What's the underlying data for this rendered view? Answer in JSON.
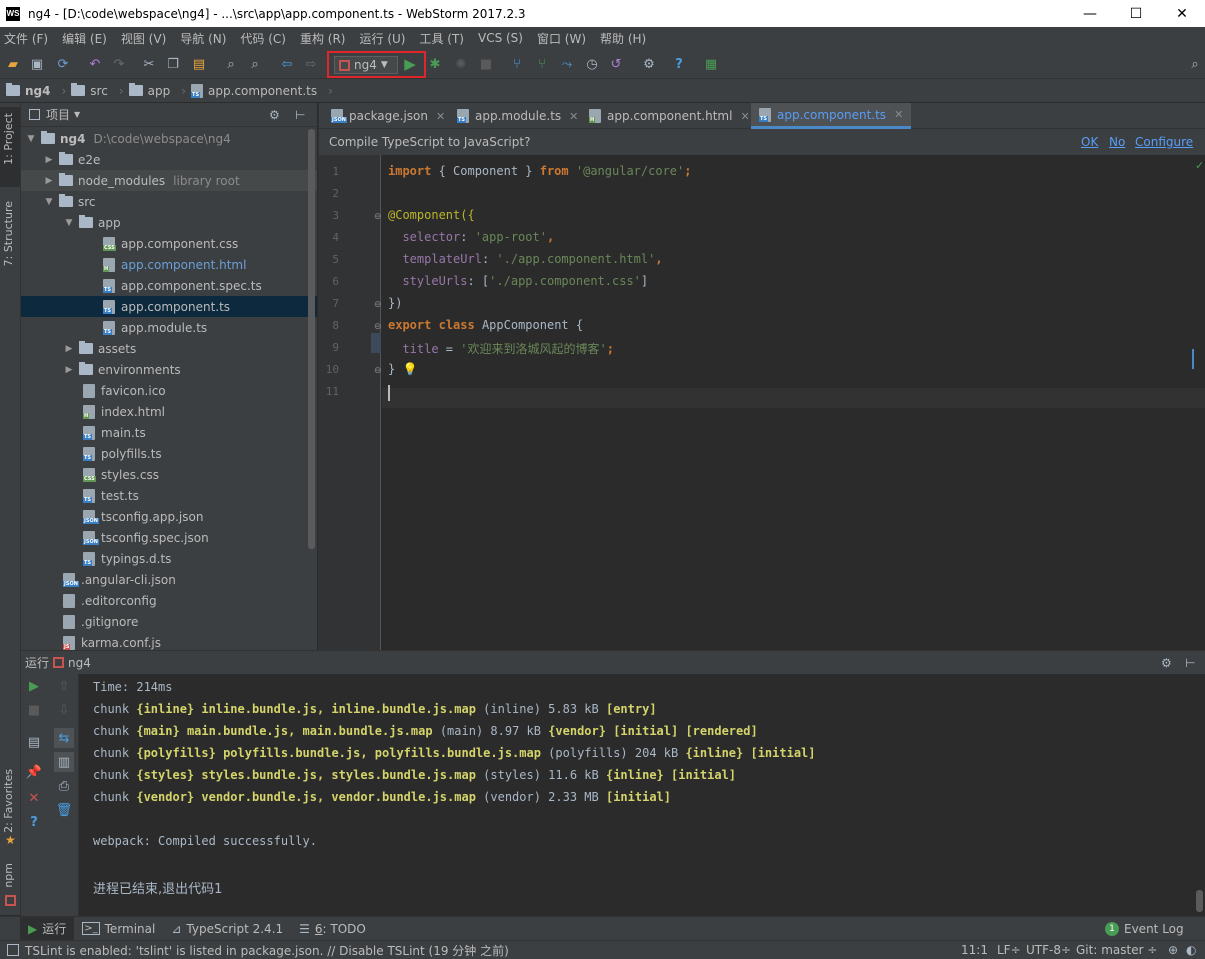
{
  "window": {
    "title": "ng4 - [D:\\code\\webspace\\ng4] - ...\\src\\app\\app.component.ts - WebStorm 2017.2.3",
    "app_icon": "WS",
    "minimize": "—",
    "maximize": "☐",
    "close": "✕"
  },
  "menu": [
    "文件 (F)",
    "编辑 (E)",
    "视图 (V)",
    "导航 (N)",
    "代码 (C)",
    "重构 (R)",
    "运行 (U)",
    "工具 (T)",
    "VCS (S)",
    "窗口 (W)",
    "帮助 (H)"
  ],
  "toolbar": {
    "run_config": "ng4",
    "highlight_color": "#e0262a"
  },
  "breadcrumb": [
    "ng4",
    "src",
    "app",
    "app.component.ts"
  ],
  "left_stripe": {
    "project": "1: Project",
    "structure": "7: Structure",
    "favorites": "2: Favorites",
    "npm": "npm"
  },
  "project_panel": {
    "title": "项目",
    "tree": [
      {
        "label": "ng4",
        "hint": "D:\\code\\webspace\\ng4",
        "type": "folder",
        "expanded": true
      },
      {
        "label": "e2e",
        "type": "folder",
        "expanded": false
      },
      {
        "label": "node_modules",
        "hint": "library root",
        "type": "folder",
        "expanded": false
      },
      {
        "label": "src",
        "type": "folder",
        "expanded": true
      },
      {
        "label": "app",
        "type": "folder",
        "expanded": true
      },
      {
        "label": "app.component.css",
        "type": "css"
      },
      {
        "label": "app.component.html",
        "type": "html"
      },
      {
        "label": "app.component.spec.ts",
        "type": "ts"
      },
      {
        "label": "app.component.ts",
        "type": "ts",
        "selected": true
      },
      {
        "label": "app.module.ts",
        "type": "ts"
      },
      {
        "label": "assets",
        "type": "folder",
        "expanded": false
      },
      {
        "label": "environments",
        "type": "folder",
        "expanded": false
      },
      {
        "label": "favicon.ico",
        "type": "file"
      },
      {
        "label": "index.html",
        "type": "html"
      },
      {
        "label": "main.ts",
        "type": "ts"
      },
      {
        "label": "polyfills.ts",
        "type": "ts"
      },
      {
        "label": "styles.css",
        "type": "css"
      },
      {
        "label": "test.ts",
        "type": "ts"
      },
      {
        "label": "tsconfig.app.json",
        "type": "json"
      },
      {
        "label": "tsconfig.spec.json",
        "type": "json"
      },
      {
        "label": "typings.d.ts",
        "type": "ts"
      },
      {
        "label": ".angular-cli.json",
        "type": "json"
      },
      {
        "label": ".editorconfig",
        "type": "file"
      },
      {
        "label": ".gitignore",
        "type": "file"
      },
      {
        "label": "karma.conf.js",
        "type": "js"
      }
    ]
  },
  "editor": {
    "tabs": [
      "package.json",
      "app.module.ts",
      "app.component.html",
      "app.component.ts"
    ],
    "active_tab": "app.component.ts",
    "notice": "Compile TypeScript to JavaScript?",
    "notice_actions": [
      "OK",
      "No",
      "Configure"
    ],
    "line_numbers": [
      "1",
      "2",
      "3",
      "4",
      "5",
      "6",
      "7",
      "8",
      "9",
      "10",
      "11"
    ],
    "code": {
      "l1_import": "import",
      "l1_mid": " { Component } ",
      "l1_from": "from",
      "l1_str": "'@angular/core'",
      "l1_end": ";",
      "l3": "@Component({",
      "l4_key": "selector",
      "l4_val": "'app-root'",
      "l5_key": "templateUrl",
      "l5_val": "'./app.component.html'",
      "l6_key": "styleUrls",
      "l6_val": "'./app.component.css'",
      "l7": "})",
      "l8_kw1": "export",
      "l8_kw2": "class",
      "l8_name": " AppComponent {",
      "l9_key": "title",
      "l9_val": "'欢迎来到洛城风起的博客'",
      "l10": "}"
    }
  },
  "run_panel": {
    "label": "运行",
    "config": "ng4",
    "lines": {
      "time": "Time: 214ms",
      "c1": [
        "chunk ",
        "{inline}",
        " inline.bundle.js, inline.bundle.js.map",
        " (inline) 5.83 kB ",
        "[entry]"
      ],
      "c2": [
        "chunk ",
        "{main}",
        " main.bundle.js, main.bundle.js.map",
        " (main) 8.97 kB ",
        "{vendor}",
        " [initial] [rendered]"
      ],
      "c3": [
        "chunk ",
        "{polyfills}",
        " polyfills.bundle.js, polyfills.bundle.js.map",
        " (polyfills) 204 kB ",
        "{inline}",
        " [initial]"
      ],
      "c4": [
        "chunk ",
        "{styles}",
        " styles.bundle.js, styles.bundle.js.map",
        " (styles) 11.6 kB ",
        "{inline}",
        " [initial]"
      ],
      "c5": [
        "chunk ",
        "{vendor}",
        " vendor.bundle.js, vendor.bundle.js.map",
        " (vendor) 2.33 MB ",
        "[initial]"
      ],
      "compiled": "webpack: Compiled successfully.",
      "exit": "进程已结束,退出代码1"
    }
  },
  "bottom_tabs": {
    "run": "运行",
    "terminal": "Terminal",
    "typescript": "TypeScript 2.4.1",
    "todo_num": "6",
    "todo": ": TODO",
    "event_log": "Event Log",
    "event_count": "1"
  },
  "status": {
    "message": "TSLint is enabled: 'tslint' is listed in package.json. // Disable TSLint (19 分钟 之前)",
    "position": "11:1",
    "line_sep": "LF÷",
    "encoding": "UTF-8÷",
    "git": "Git: master ÷"
  }
}
